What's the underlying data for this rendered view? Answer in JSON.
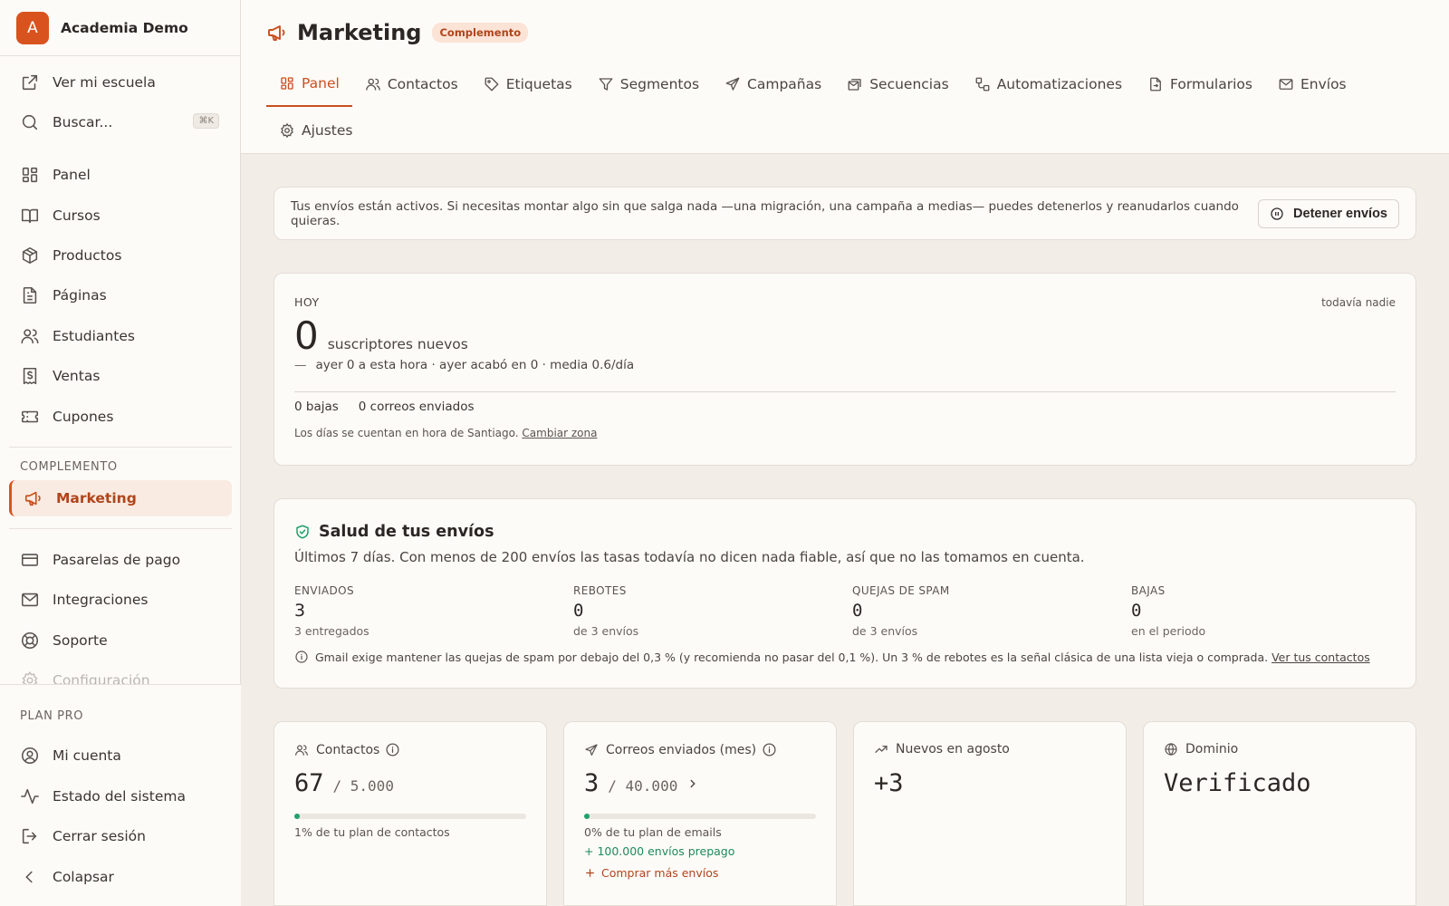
{
  "sidebar": {
    "brand": {
      "initial": "A",
      "name": "Academia Demo"
    },
    "top_items": [
      {
        "label": "Ver mi escuela",
        "icon": "external-link-icon"
      },
      {
        "label": "Buscar...",
        "icon": "search-icon",
        "shortcut": "⌘K"
      }
    ],
    "main_items": [
      {
        "label": "Panel",
        "icon": "dashboard-icon"
      },
      {
        "label": "Cursos",
        "icon": "book-icon"
      },
      {
        "label": "Productos",
        "icon": "package-icon"
      },
      {
        "label": "Páginas",
        "icon": "file-text-icon"
      },
      {
        "label": "Estudiantes",
        "icon": "users-icon"
      },
      {
        "label": "Ventas",
        "icon": "receipt-icon"
      },
      {
        "label": "Cupones",
        "icon": "ticket-icon"
      }
    ],
    "addon_heading": "COMPLEMENTO",
    "addon_item": {
      "label": "Marketing",
      "icon": "megaphone-icon"
    },
    "config_items": [
      {
        "label": "Pasarelas de pago",
        "icon": "credit-card-icon"
      },
      {
        "label": "Integraciones",
        "icon": "mail-icon"
      },
      {
        "label": "Soporte",
        "icon": "lifebuoy-icon"
      },
      {
        "label": "Configuración",
        "icon": "gear-icon"
      }
    ],
    "plan_heading": "PLAN PRO",
    "bottom_items": [
      {
        "label": "Mi cuenta",
        "icon": "user-circle-icon"
      },
      {
        "label": "Estado del sistema",
        "icon": "activity-icon"
      },
      {
        "label": "Cerrar sesión",
        "icon": "logout-icon"
      },
      {
        "label": "Colapsar",
        "icon": "chevron-left-icon"
      }
    ]
  },
  "header": {
    "title": "Marketing",
    "badge": "Complemento",
    "tabs": [
      {
        "label": "Panel",
        "icon": "dashboard-icon",
        "active": true
      },
      {
        "label": "Contactos",
        "icon": "users-icon"
      },
      {
        "label": "Etiquetas",
        "icon": "tag-icon"
      },
      {
        "label": "Segmentos",
        "icon": "filter-icon"
      },
      {
        "label": "Campañas",
        "icon": "send-icon"
      },
      {
        "label": "Secuencias",
        "icon": "stack-mail-icon"
      },
      {
        "label": "Automatizaciones",
        "icon": "workflow-icon"
      },
      {
        "label": "Formularios",
        "icon": "form-icon"
      },
      {
        "label": "Envíos",
        "icon": "mail-icon"
      },
      {
        "label": "Ajustes",
        "icon": "gear-icon"
      }
    ]
  },
  "notice": {
    "text": "Tus envíos están activos. Si necesitas montar algo sin que salga nada —una migración, una campaña a medias— puedes detenerlos y reanudarlos cuando quieras.",
    "button": "Detener envíos"
  },
  "today": {
    "label": "HOY",
    "status": "todavía nadie",
    "count": "0",
    "count_label": "suscriptores nuevos",
    "trend_dash": "—",
    "comparison": "ayer 0 a esta hora · ayer acabó en 0 · media 0.6/día",
    "unsubscribes": "0 bajas",
    "emails_sent": "0 correos enviados",
    "tz_note": "Los días se cuentan en hora de Santiago.",
    "tz_link": "Cambiar zona"
  },
  "health": {
    "title": "Salud de tus envíos",
    "subtitle": "Últimos 7 días. Con menos de 200 envíos las tasas todavía no dicen nada fiable, así que no las tomamos en cuenta.",
    "stats": [
      {
        "label": "ENVIADOS",
        "value": "3",
        "sub": "3 entregados"
      },
      {
        "label": "REBOTES",
        "value": "0",
        "sub": "de 3 envíos"
      },
      {
        "label": "QUEJAS DE SPAM",
        "value": "0",
        "sub": "de 3 envíos"
      },
      {
        "label": "BAJAS",
        "value": "0",
        "sub": "en el periodo"
      }
    ],
    "footnote": "Gmail exige mantener las quejas de spam por debajo del 0,3 % (y recomienda no pasar del 0,1 %). Un 3 % de rebotes es la señal clásica de una lista vieja o comprada.",
    "footnote_link": "Ver tus contactos"
  },
  "cards": {
    "contacts": {
      "title": "Contactos",
      "value": "67",
      "limit": "/ 5.000",
      "progress": 0.0134,
      "sub": "1% de tu plan de contactos"
    },
    "emails": {
      "title": "Correos enviados (mes)",
      "value": "3",
      "limit": "/ 40.000",
      "progress": 0.0001,
      "sub": "0% de tu plan de emails",
      "prepaid": "+ 100.000 envíos prepago",
      "buy": "Comprar más envíos"
    },
    "new": {
      "title": "Nuevos en agosto",
      "value": "+3"
    },
    "domain": {
      "title": "Dominio",
      "value": "Verificado"
    }
  },
  "colors": {
    "accent": "#d9531e",
    "success": "#22a06b",
    "background": "#f3ede8",
    "surface": "#fdfbf8"
  }
}
